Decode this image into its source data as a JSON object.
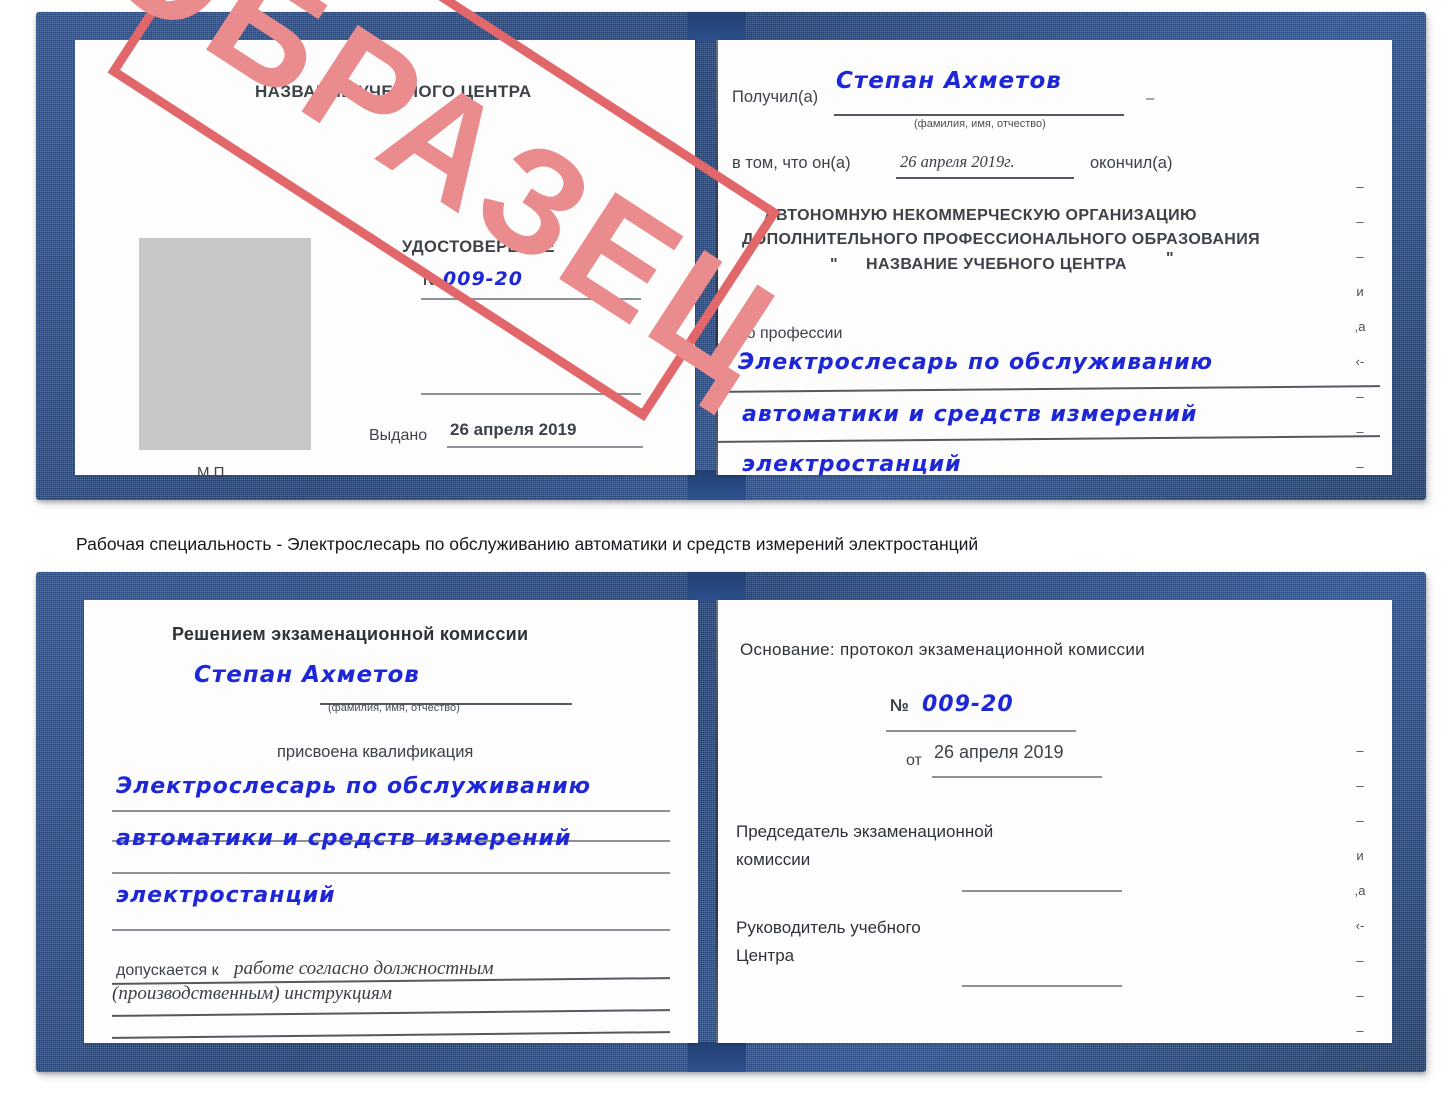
{
  "caption": "Рабочая специальность - Электрослесарь по обслуживанию автоматики и средств измерений электростанций",
  "stamp": {
    "label": "ОБРАЗЕЦ",
    "border_color": "#e2676a",
    "text_color": "#ea8c8d"
  },
  "colors": {
    "cover_blue": "#2d5392",
    "handwriting_blue": "#1d27d8",
    "photo_placeholder_gray": "#c7c7c7",
    "rule_gray": "#8d9097",
    "print_gray": "#3a3f46"
  },
  "certificate_top": {
    "left_page": {
      "center_name": "НАЗВАНИЕ УЧЕБНОГО ЦЕНТРА",
      "doc_type": "УДОСТОВЕРЕНИЕ",
      "number_label": "№",
      "number_value": "009-20",
      "issued_label": "Выдано",
      "issued_date": "26 апреля 2019",
      "seal_label": "М.П."
    },
    "right_page": {
      "received_label": "Получил(а)",
      "received_name": "Степан Ахметов",
      "fio_hint": "(фамилия, имя, отчество)",
      "in_that_label": "в том, что он(а)",
      "completion_date": "26 апреля 2019г.",
      "finished_label": "окончил(а)",
      "org_line1": "АВТОНОМНУЮ НЕКОММЕРЧЕСКУЮ ОРГАНИЗАЦИЮ",
      "org_line2": "ДОПОЛНИТЕЛЬНОГО ПРОФЕССИОНАЛЬНОГО ОБРАЗОВАНИЯ",
      "org_quote_open": "\"",
      "org_line3": "НАЗВАНИЕ УЧЕБНОГО ЦЕНТРА",
      "org_quote_close": "\"",
      "profession_label": "по профессии",
      "profession_line1": "Электрослесарь по обслуживанию",
      "profession_line2": "автоматики и средств измерений",
      "profession_line3": "электростанций",
      "edge_marks": [
        "–",
        "–",
        "–",
        "и",
        ",а",
        "‹-",
        "–",
        "–",
        "–"
      ]
    }
  },
  "certificate_bottom": {
    "left_page": {
      "heading": "Решением экзаменационной комиссии",
      "name": "Степан Ахметов",
      "fio_hint": "(фамилия, имя, отчество)",
      "qualification_label": "присвоена квалификация",
      "qualification_line1": "Электрослесарь по обслуживанию",
      "qualification_line2": "автоматики и средств измерений",
      "qualification_line3": "электростанций",
      "admitted_label": "допускается к",
      "admitted_line1": "работе согласно должностным",
      "admitted_line2": "(производственным) инструкциям"
    },
    "right_page": {
      "basis_label": "Основание: протокол экзаменационной комиссии",
      "number_label": "№",
      "number_value": "009-20",
      "date_label": "от",
      "date_value": "26 апреля 2019",
      "chairman_line1": "Председатель экзаменационной",
      "chairman_line2": "комиссии",
      "head_line1": "Руководитель учебного",
      "head_line2": "Центра",
      "edge_marks": [
        "–",
        "–",
        "–",
        "и",
        ",а",
        "‹-",
        "–",
        "–",
        "–",
        "–"
      ]
    }
  }
}
